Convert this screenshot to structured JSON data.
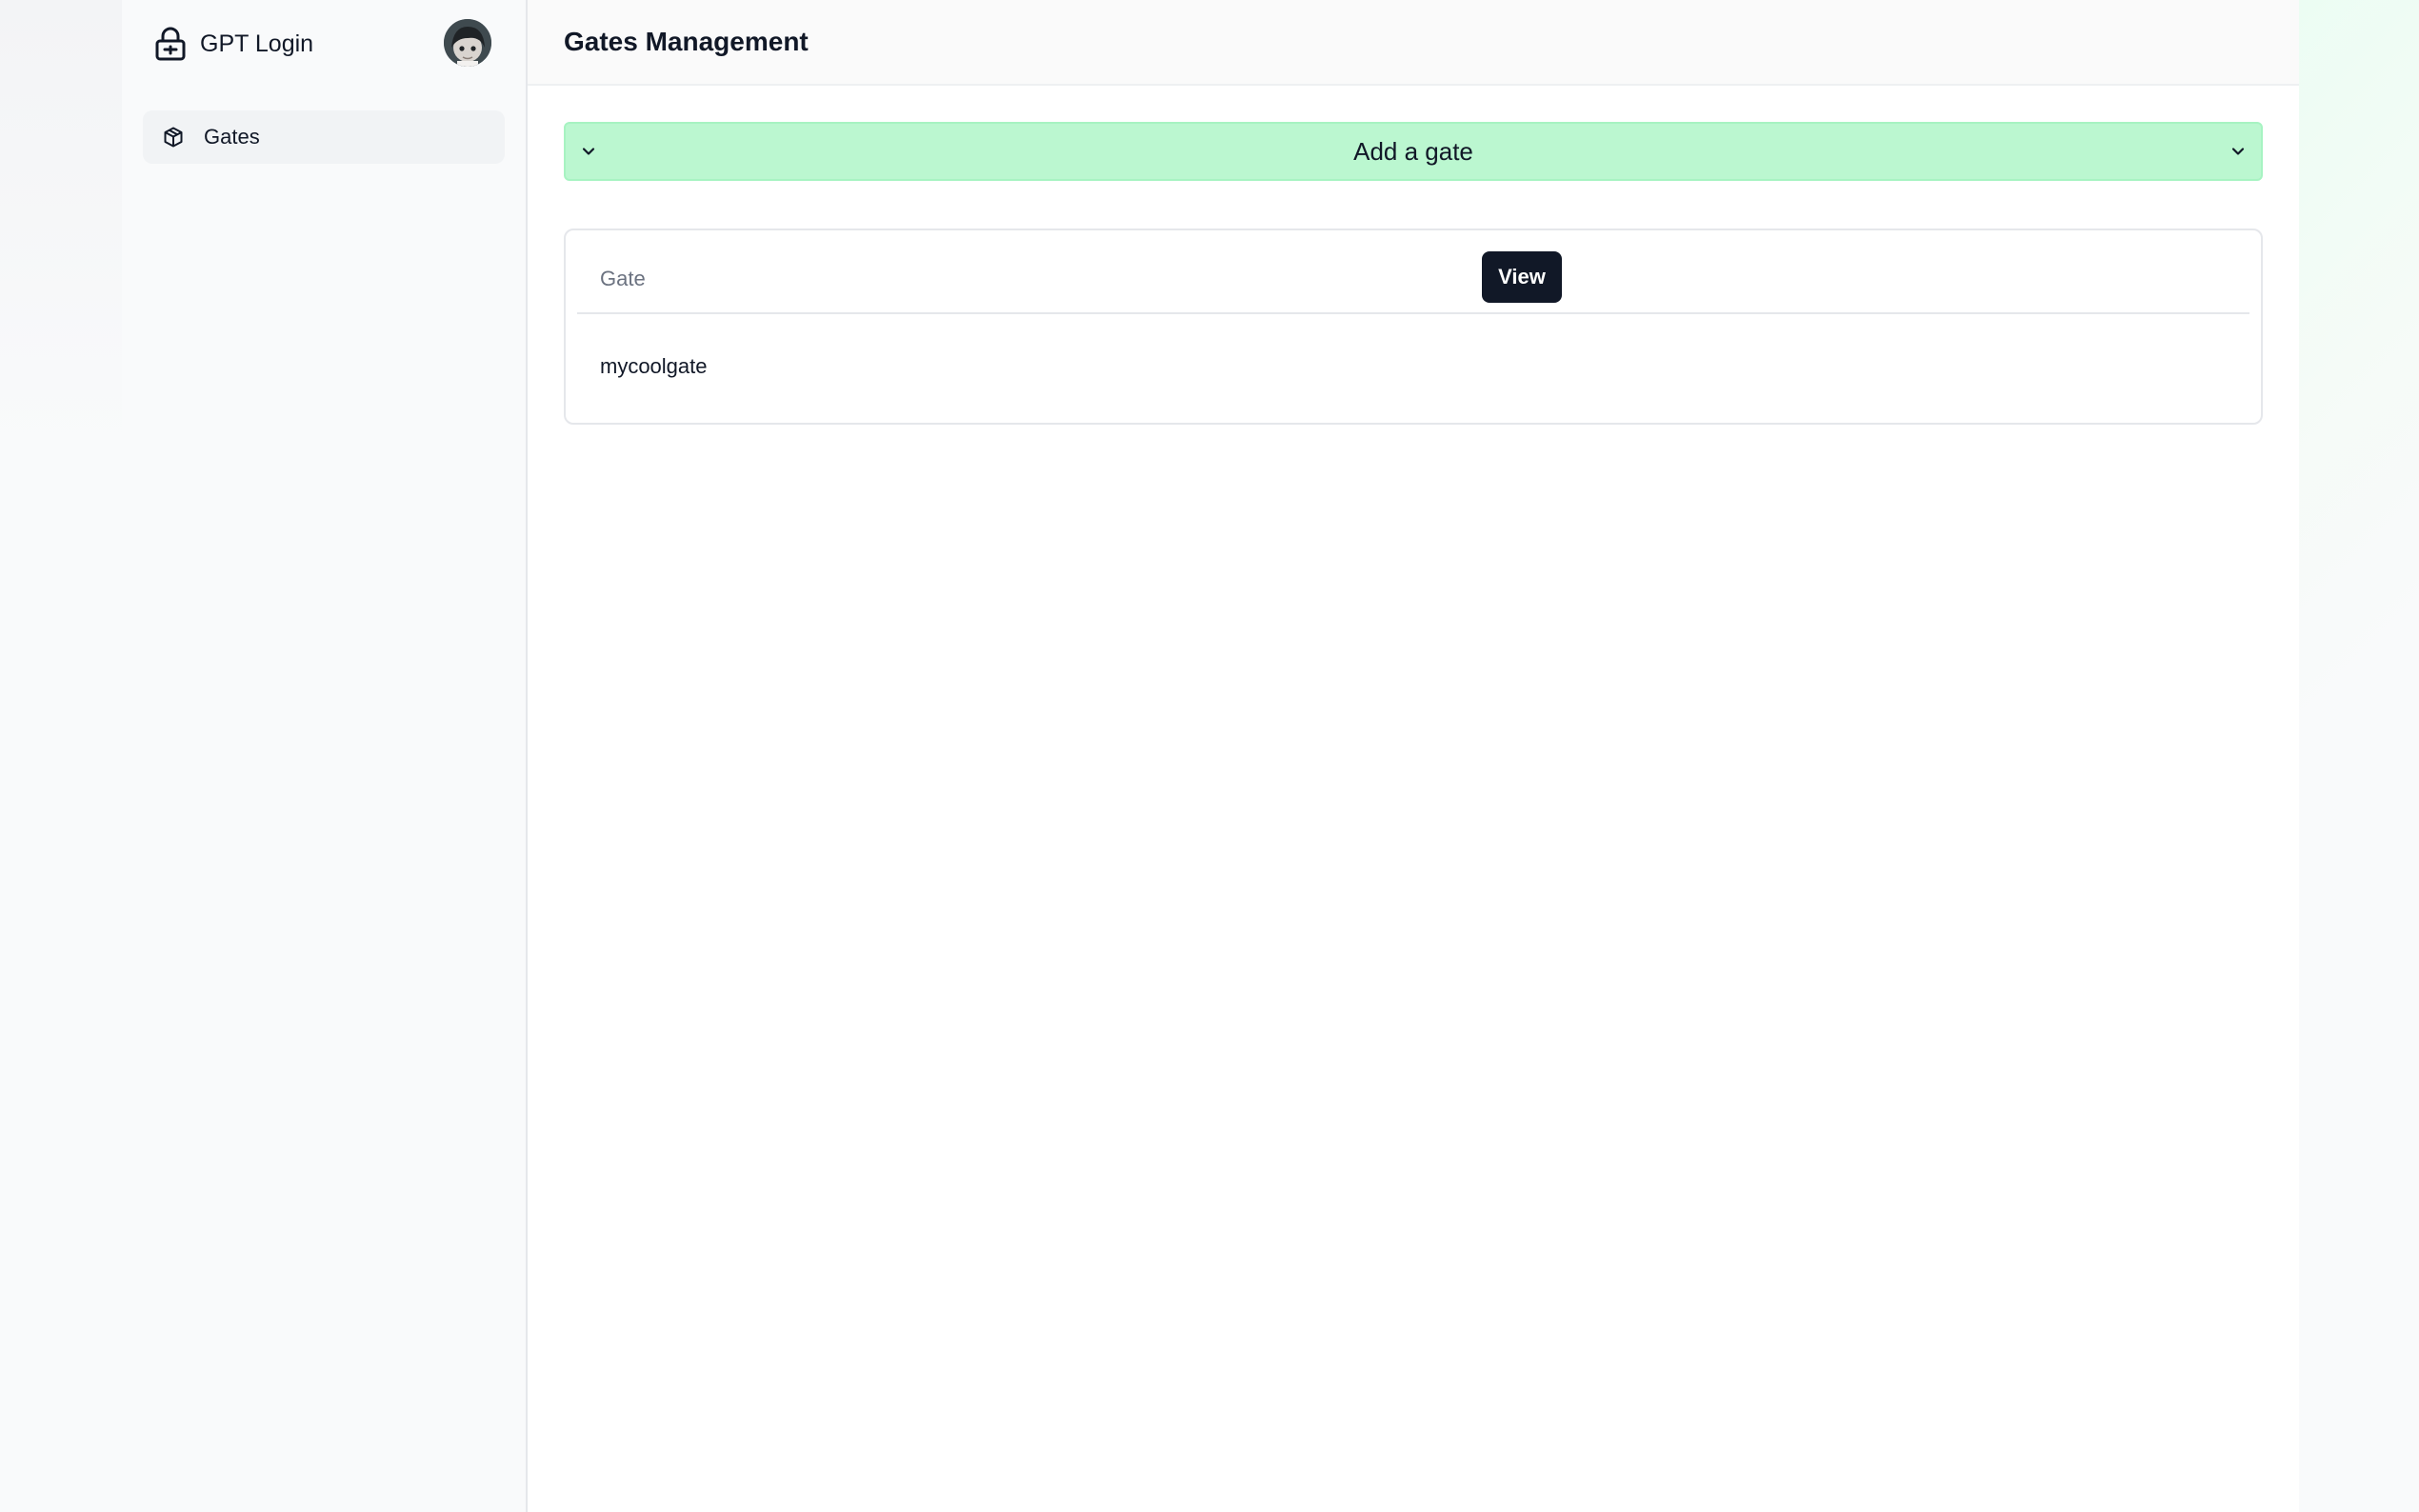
{
  "app": {
    "title": "GPT Login",
    "brand_icon": "lock-icon",
    "avatar": "user-avatar"
  },
  "sidebar": {
    "items": [
      {
        "label": "Gates",
        "icon": "box-icon",
        "active": true
      }
    ]
  },
  "header": {
    "title": "Gates Management"
  },
  "add_gate": {
    "label": "Add a gate",
    "icon": "chevron-down-icon",
    "expanded": false
  },
  "gates_table": {
    "columns": [
      "Gate"
    ],
    "rows": [
      {
        "name": "mycoolgate",
        "action_label": "View"
      }
    ]
  },
  "colors": {
    "accent_green": "#bbf7d0",
    "button_dark": "#111827",
    "sidebar_bg": "#f9fafb",
    "nav_active_bg": "#f1f3f5"
  }
}
